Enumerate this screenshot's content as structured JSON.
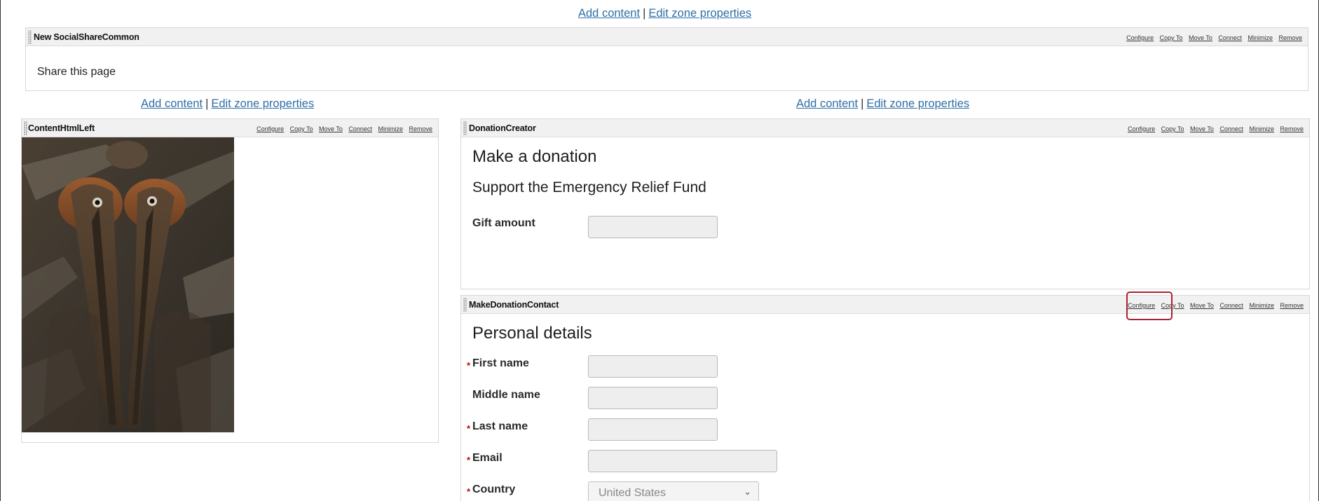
{
  "zone_top": {
    "add_content": "Add content",
    "separator": "|",
    "edit_zone": "Edit zone properties"
  },
  "zone_left": {
    "add_content": "Add content",
    "separator": "|",
    "edit_zone": "Edit zone properties"
  },
  "zone_right": {
    "add_content": "Add content",
    "separator": "|",
    "edit_zone": "Edit zone properties"
  },
  "part_actions": {
    "configure": "Configure",
    "copy_to": "Copy To",
    "move_to": "Move To",
    "connect": "Connect",
    "minimize": "Minimize",
    "remove": "Remove"
  },
  "social_part": {
    "title": "New SocialShareCommon",
    "text": "Share this page"
  },
  "html_left_part": {
    "title": "ContentHtmlLeft",
    "image_alt": "Two brown pelicans"
  },
  "donation_part": {
    "title": "DonationCreator",
    "heading": "Make a donation",
    "subheading": "Support the Emergency Relief Fund",
    "gift_label": "Gift amount"
  },
  "contact_part": {
    "title": "MakeDonationContact",
    "heading": "Personal details",
    "first_name": "First name",
    "middle_name": "Middle name",
    "last_name": "Last name",
    "email": "Email",
    "country": "Country",
    "country_value": "United States",
    "required_mark": "*"
  },
  "colors": {
    "link": "#2f6fa6",
    "required": "#cc0000",
    "highlight": "#a8232f",
    "header_bg": "#f1f1f1"
  }
}
